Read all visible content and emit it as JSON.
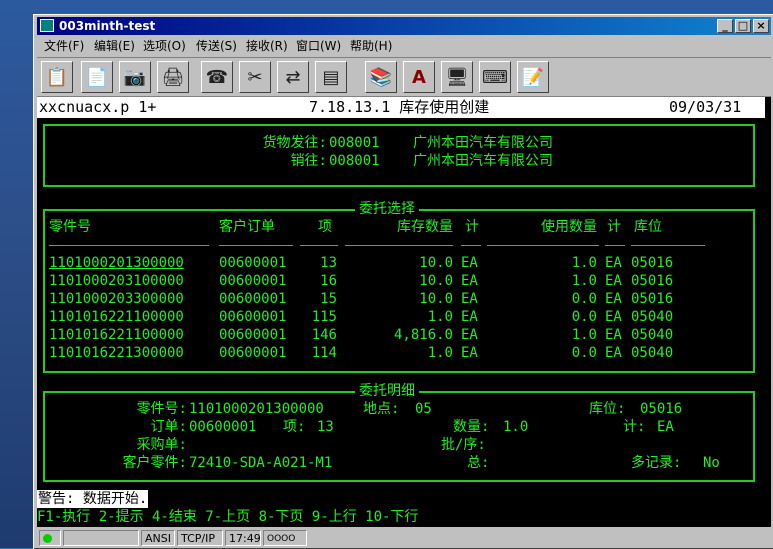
{
  "window": {
    "title": "003minth-test"
  },
  "menu": [
    "文件(F)",
    "编辑(E)",
    "选项(O)",
    "传送(S)",
    "接收(R)",
    "窗口(W)",
    "帮助(H)"
  ],
  "toolbar": [
    "paste-icon",
    "copy-icon",
    "camera-icon",
    "print-icon",
    "phone-icon",
    "disconnect-icon",
    "transfer-icon",
    "layout-icon",
    "books-icon",
    "spell-check-icon",
    "computer-icon",
    "keyboard-icon",
    "notepad-icon"
  ],
  "header": {
    "program": "xxcnuacx.p 1+",
    "title": "7.18.13.1 库存使用创建",
    "date": "09/03/31"
  },
  "ship": {
    "ship_to_label": "货物发往:",
    "ship_to_code": "008001",
    "ship_to_name": "广州本田汽车有限公司",
    "sold_to_label": "销往:",
    "sold_to_code": "008001",
    "sold_to_name": "广州本田汽车有限公司"
  },
  "selection": {
    "legend": "委托选择",
    "columns": {
      "part": "零件号",
      "order": "客户订单",
      "line": "项",
      "stock": "库存数量",
      "um1": "计",
      "used": "使用数量",
      "um2": "计",
      "loc": "库位"
    },
    "rows": [
      {
        "part": "1101000201300000",
        "order": "00600001",
        "line": "13",
        "stock": "10.0",
        "um1": "EA",
        "used": "1.0",
        "um2": "EA",
        "loc": "05016"
      },
      {
        "part": "1101000203100000",
        "order": "00600001",
        "line": "16",
        "stock": "10.0",
        "um1": "EA",
        "used": "1.0",
        "um2": "EA",
        "loc": "05016"
      },
      {
        "part": "1101000203300000",
        "order": "00600001",
        "line": "15",
        "stock": "10.0",
        "um1": "EA",
        "used": "0.0",
        "um2": "EA",
        "loc": "05016"
      },
      {
        "part": "1101016221100000",
        "order": "00600001",
        "line": "115",
        "stock": "1.0",
        "um1": "EA",
        "used": "0.0",
        "um2": "EA",
        "loc": "05040"
      },
      {
        "part": "1101016221100000",
        "order": "00600001",
        "line": "146",
        "stock": "4,816.0",
        "um1": "EA",
        "used": "1.0",
        "um2": "EA",
        "loc": "05040"
      },
      {
        "part": "1101016221300000",
        "order": "00600001",
        "line": "114",
        "stock": "1.0",
        "um1": "EA",
        "used": "0.0",
        "um2": "EA",
        "loc": "05040"
      }
    ]
  },
  "detail": {
    "legend": "委托明细",
    "part_label": "零件号:",
    "part_value": "1101000201300000",
    "site_label": "地点:",
    "site_value": "05",
    "loc_label": "库位:",
    "loc_value": "05016",
    "order_label": "订单:",
    "order_value": "00600001",
    "line_label": "项:",
    "line_value": "13",
    "qty_label": "数量:",
    "qty_value": "1.0",
    "um_label": "计:",
    "um_value": "EA",
    "po_label": "采购单:",
    "lot_label": "批/序:",
    "cust_part_label": "客户零件:",
    "cust_part_value": "72410-SDA-A021-M1",
    "total_label": "总:",
    "multi_label": "多记录:",
    "multi_value": "No"
  },
  "warning": "警告: 数据开始.",
  "fkeys": "F1-执行 2-提示 4-结束 7-上页 8-下页 9-上行 10-下行",
  "status": {
    "ansi": "ANSI",
    "proto": "TCP/IP",
    "time": "17:49",
    "leds": "OOOO"
  }
}
